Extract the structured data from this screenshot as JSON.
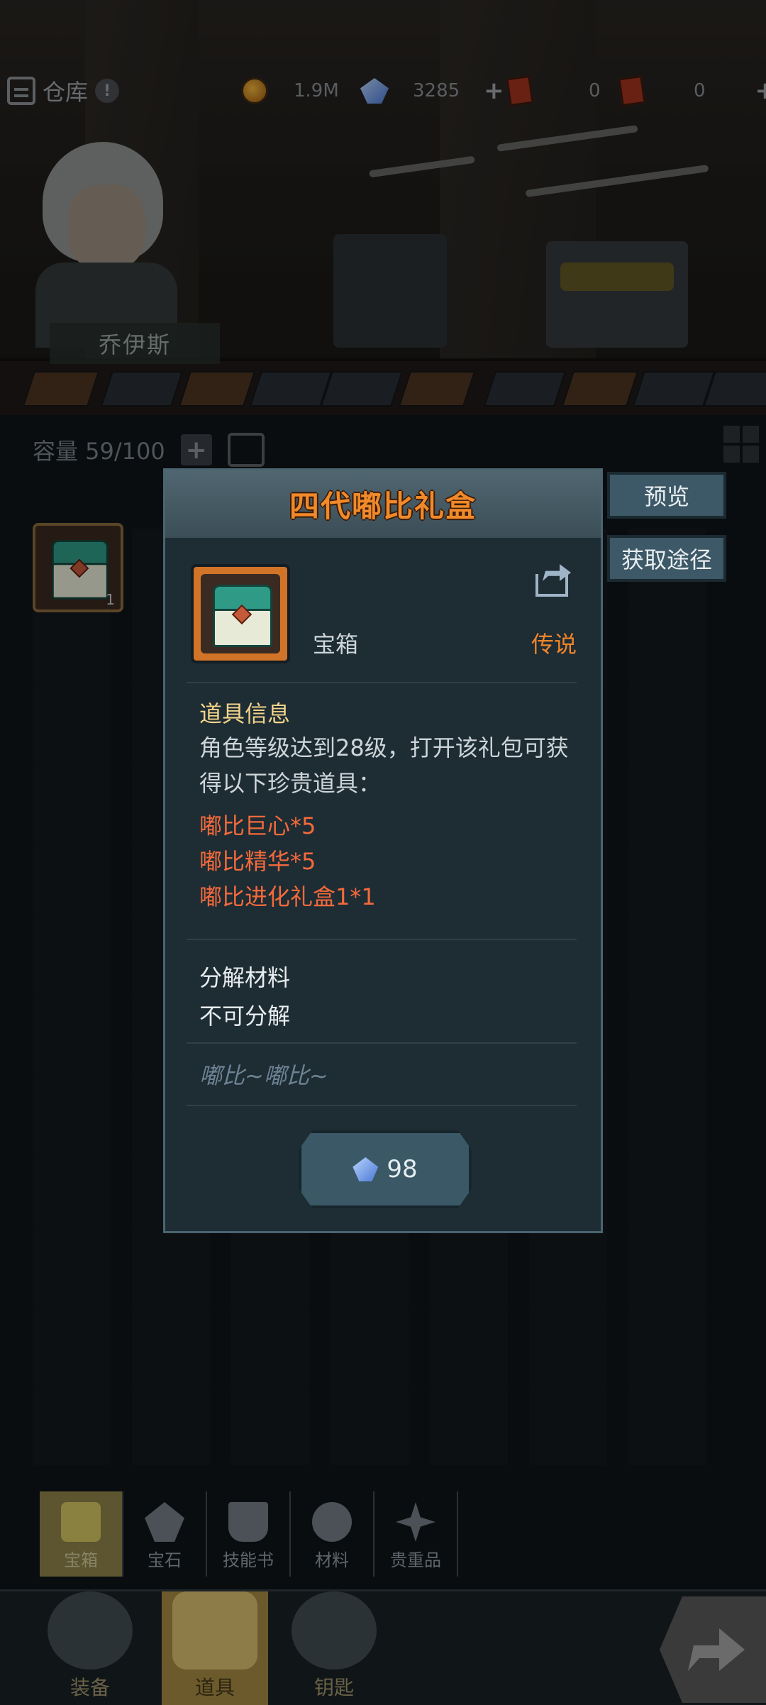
{
  "topbar": {
    "title": "仓库",
    "info_icon": "!",
    "coins": "1.9M",
    "gems": "3285",
    "ticket1": "0",
    "ticket2": "0"
  },
  "hero": {
    "name": "乔伊斯"
  },
  "inventory": {
    "capacity": "容量 59/100",
    "selected_count": "1"
  },
  "popup": {
    "title": "四代嘟比礼盒",
    "item_type": "宝箱",
    "rarity": "传说",
    "info_title": "道具信息",
    "description": "角色等级达到28级，打开该礼包可获得以下珍贵道具：",
    "rewards": [
      "嘟比巨心*5",
      "嘟比精华*5",
      "嘟比进化礼盒1*1"
    ],
    "decompose_title": "分解材料",
    "decompose_value": "不可分解",
    "flavor": "嘟比~嘟比~",
    "price": "98"
  },
  "side_buttons": {
    "preview": "预览",
    "source": "获取途径"
  },
  "categories": [
    {
      "label": "宝箱",
      "icon": "chest-icon",
      "active": true
    },
    {
      "label": "宝石",
      "icon": "gem-icon",
      "active": false
    },
    {
      "label": "技能书",
      "icon": "book-icon",
      "active": false
    },
    {
      "label": "材料",
      "icon": "material-icon",
      "active": false
    },
    {
      "label": "贵重品",
      "icon": "valuable-icon",
      "active": false
    }
  ],
  "nav": [
    {
      "label": "装备",
      "icon": "equipment-icon",
      "active": false
    },
    {
      "label": "道具",
      "icon": "item-chest-icon",
      "active": true
    },
    {
      "label": "钥匙",
      "icon": "key-icon",
      "active": false
    }
  ],
  "colors": {
    "accent": "#f08a2a",
    "reward": "#f36a3b",
    "section": "#f2d58b"
  }
}
